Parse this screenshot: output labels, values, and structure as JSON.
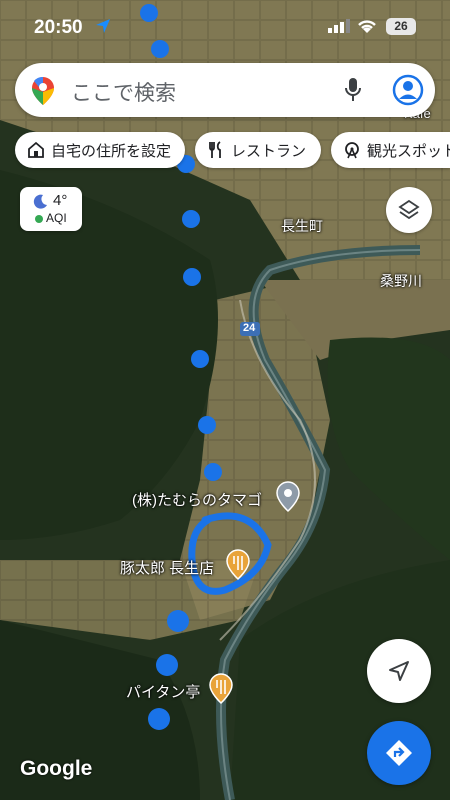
{
  "status": {
    "time": "20:50",
    "battery": "26"
  },
  "search": {
    "placeholder": "ここで検索"
  },
  "chips": [
    {
      "label": "自宅の住所を設定",
      "icon": "home-icon"
    },
    {
      "label": "レストラン",
      "icon": "restaurant-icon"
    },
    {
      "label": "観光スポット",
      "icon": "attraction-icon"
    }
  ],
  "weather": {
    "temp": "4°",
    "aqi_label": "AQI"
  },
  "map_labels": {
    "town": "長生町",
    "river": "桑野川",
    "route": "24",
    "cafe": "Kafe",
    "poi_1": "(株)たむらのタマゴ",
    "poi_2": "豚太郎 長生店",
    "poi_3": "パイタン亭"
  },
  "branding": {
    "logo": "Google"
  },
  "colors": {
    "accent": "#1a73e8",
    "route_dots": "#1a73e8",
    "poi_food": "#e8a33a"
  }
}
